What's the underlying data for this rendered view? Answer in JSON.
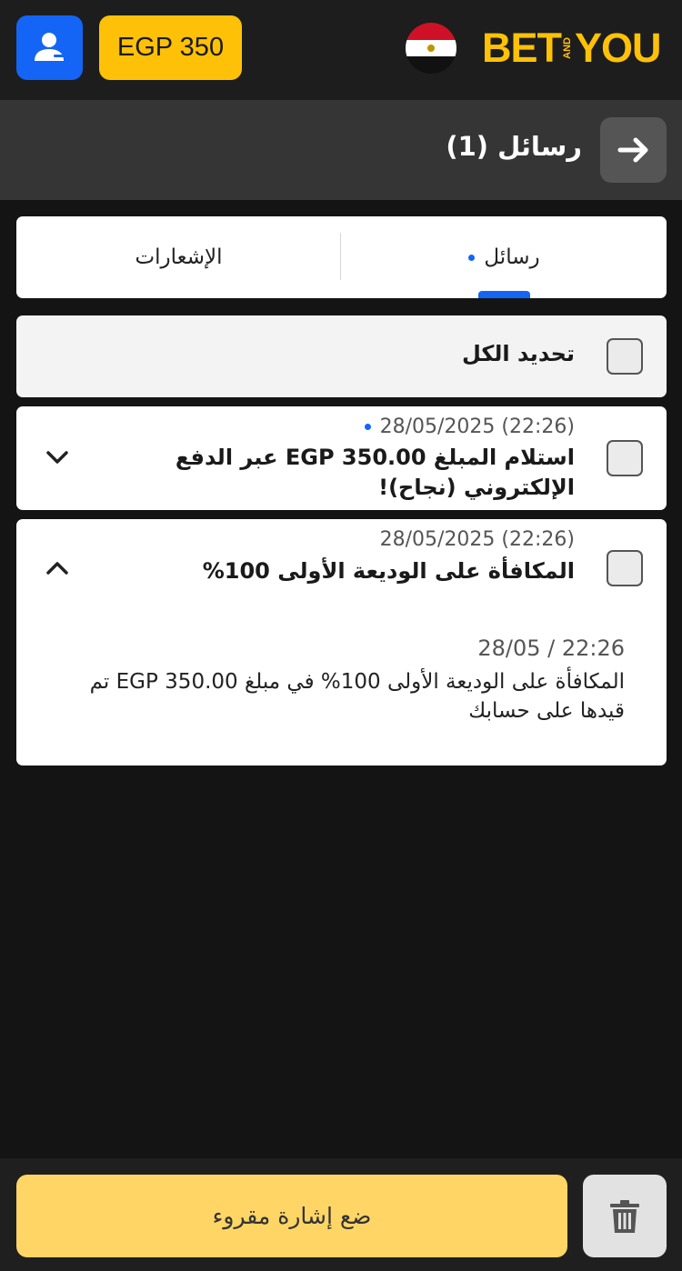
{
  "header": {
    "balance": "EGP 350",
    "logo_left": "BET",
    "logo_and": "AND",
    "logo_right": "YOU",
    "user_icon": "user-icon",
    "flag_icon": "egypt-flag-icon"
  },
  "titlebar": {
    "title": "رسائل (1)",
    "back_icon": "arrow-right-icon"
  },
  "tabs": {
    "messages": "رسائل",
    "notifications": "الإشعارات",
    "active": "messages"
  },
  "select_all": {
    "label": "تحديد الكل"
  },
  "messages": [
    {
      "date": "28/05/2025 (22:26)",
      "unread": true,
      "subject": "استلام المبلغ EGP 350.00 عبر الدفع الإلكتروني (نجاح)!",
      "expanded": false
    },
    {
      "date": "28/05/2025 (22:26)",
      "unread": false,
      "subject": "المكافأة على الوديعة الأولى 100%",
      "expanded": true,
      "body_time": "28/05 / 22:26",
      "body_text": "المكافأة على الوديعة الأولى 100% في مبلغ EGP 350.00 تم قيدها على حسابك"
    }
  ],
  "bottom": {
    "mark_read": "ضع إشارة مقروء",
    "delete_icon": "trash-icon"
  },
  "colors": {
    "accent_blue": "#1465f5",
    "accent_yellow": "#ffc107",
    "button_yellow": "#ffd666",
    "background": "#141414"
  }
}
